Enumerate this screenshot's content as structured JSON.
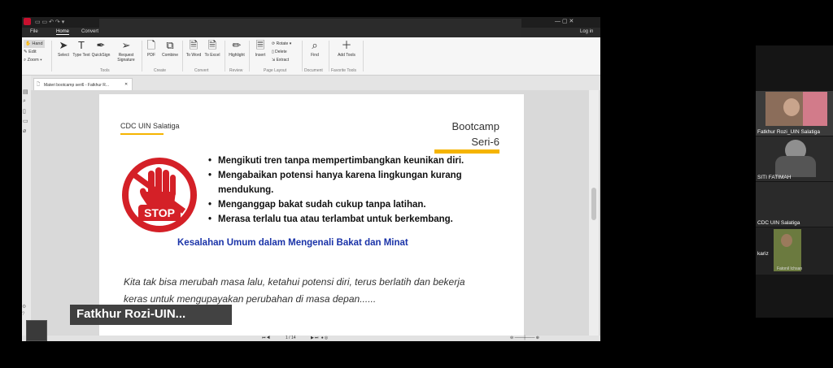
{
  "app": {
    "menu": [
      "File",
      "Home",
      "Convert"
    ],
    "sign_in": "Log in",
    "left_tools": [
      "Hand",
      "Edit",
      "Zoom"
    ],
    "tools": [
      {
        "label": "Select",
        "icon": "cursor-icon"
      },
      {
        "label": "Type Text",
        "icon": "type-text-icon"
      },
      {
        "label": "QuickSign",
        "icon": "pen-icon"
      },
      {
        "label": "Request Signature",
        "icon": "send-icon"
      },
      {
        "label": "PDF",
        "icon": "pdf-icon"
      },
      {
        "label": "Combine",
        "icon": "combine-icon"
      },
      {
        "label": "To Word",
        "icon": "to-word-icon"
      },
      {
        "label": "To Excel",
        "icon": "to-excel-icon"
      },
      {
        "label": "Highlight",
        "icon": "highlight-icon"
      },
      {
        "label": "Insert",
        "icon": "insert-icon"
      },
      {
        "label": "Rotate",
        "icon": "rotate-icon"
      },
      {
        "label": "Delete",
        "icon": "delete-icon"
      },
      {
        "label": "Extract",
        "icon": "extract-icon"
      },
      {
        "label": "Find",
        "icon": "search-icon"
      },
      {
        "label": "Add Tools",
        "icon": "plus-icon"
      }
    ],
    "groups": [
      "Tools",
      "Create",
      "Convert",
      "Review",
      "Page Layout",
      "Document",
      "Favorite Tools"
    ],
    "tab_title": "Materi bootcamp seri6 - Fatkhur R...",
    "page_indicator": "1 / 14"
  },
  "slide": {
    "brand": "CDC UIN Salatiga",
    "title_line1": "Bootcamp",
    "title_line2": "Seri-6",
    "stop_text": "STOP",
    "bullets": [
      "Mengikuti tren tanpa mempertimbangkan keunikan diri.",
      "Mengabaikan potensi hanya karena lingkungan kurang",
      "mendukung.",
      "Menganggap bakat sudah cukup tanpa latihan.",
      "Merasa terlalu tua atau terlambat untuk berkembang."
    ],
    "subheading": "Kesalahan Umum dalam Mengenali Bakat dan Minat",
    "quote_line1": "Kita tak bisa merubah masa lalu, ketahui potensi diri, terus berlatih dan bekerja",
    "quote_line2": "keras untuk mengupayakan perubahan di masa depan......"
  },
  "speaker_label": "Fatkhur  Rozi-UIN...",
  "participants": [
    {
      "name": "Fatkhur Rozi_UIN Salatiga"
    },
    {
      "name": "SITI FATIMAH"
    },
    {
      "name": "CDC UIN Salatiga"
    },
    {
      "name": "kariz",
      "caption": "Fatonil Ichsan"
    }
  ],
  "colors": {
    "accent_yellow": "#f5b400",
    "stop_red": "#d42027",
    "subheading_blue": "#1a33a8"
  }
}
